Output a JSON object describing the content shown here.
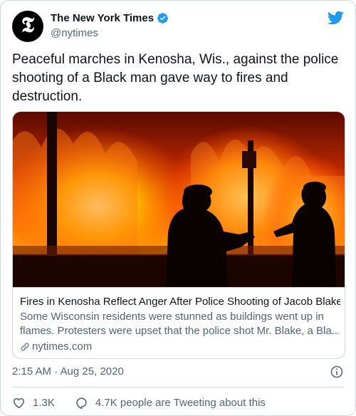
{
  "account": {
    "name": "The New York Times",
    "handle": "@nytimes",
    "avatar_glyph": "𝕿",
    "verified": true
  },
  "tweet": {
    "text": "Peaceful marches in Kenosha, Wis., against the police shooting of a Black man gave way to fires and destruction."
  },
  "link_card": {
    "title": "Fires in Kenosha Reflect Anger After Police Shooting of Jacob Blake",
    "description_line1": "Some Wisconsin residents were stunned as buildings went up in",
    "description_line2": "flames. Protesters were upset that the police shot Mr. Blake, a Bla...",
    "domain": "nytimes.com"
  },
  "meta": {
    "timestamp": "2:15 AM · Aug 25, 2020"
  },
  "actions": {
    "likes": "1.3K",
    "conversation": "4.7K people are Tweeting about this"
  },
  "colors": {
    "text": "#0f1419",
    "secondary": "#536471",
    "twitter_blue": "#1d9bf0",
    "border": "#cfd9de"
  },
  "icons": [
    "twitter-bird-icon",
    "verified-badge-icon",
    "link-icon",
    "info-icon",
    "heart-icon",
    "reply-icon"
  ]
}
